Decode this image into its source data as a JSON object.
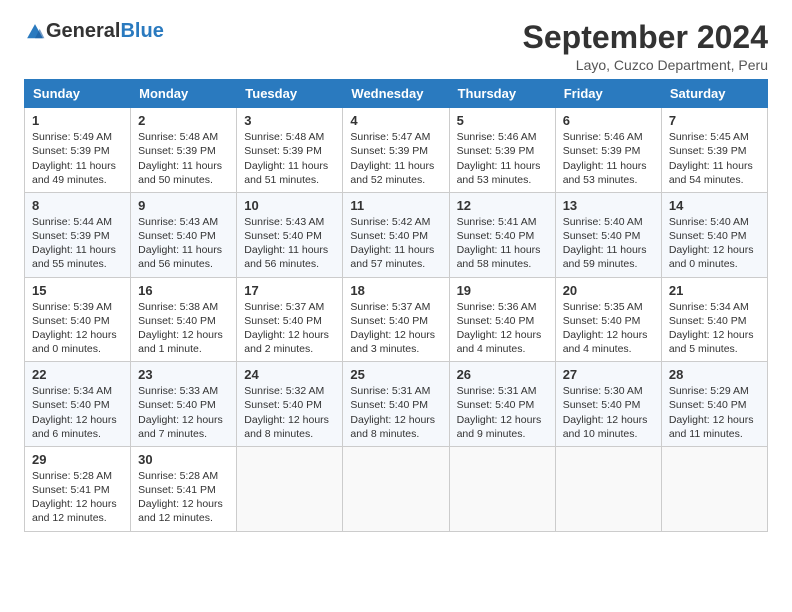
{
  "header": {
    "logo_general": "General",
    "logo_blue": "Blue",
    "month_title": "September 2024",
    "location": "Layo, Cuzco Department, Peru"
  },
  "weekdays": [
    "Sunday",
    "Monday",
    "Tuesday",
    "Wednesday",
    "Thursday",
    "Friday",
    "Saturday"
  ],
  "weeks": [
    [
      {
        "day": "1",
        "sunrise": "5:49 AM",
        "sunset": "5:39 PM",
        "daylight": "11 hours and 49 minutes."
      },
      {
        "day": "2",
        "sunrise": "5:48 AM",
        "sunset": "5:39 PM",
        "daylight": "11 hours and 50 minutes."
      },
      {
        "day": "3",
        "sunrise": "5:48 AM",
        "sunset": "5:39 PM",
        "daylight": "11 hours and 51 minutes."
      },
      {
        "day": "4",
        "sunrise": "5:47 AM",
        "sunset": "5:39 PM",
        "daylight": "11 hours and 52 minutes."
      },
      {
        "day": "5",
        "sunrise": "5:46 AM",
        "sunset": "5:39 PM",
        "daylight": "11 hours and 53 minutes."
      },
      {
        "day": "6",
        "sunrise": "5:46 AM",
        "sunset": "5:39 PM",
        "daylight": "11 hours and 53 minutes."
      },
      {
        "day": "7",
        "sunrise": "5:45 AM",
        "sunset": "5:39 PM",
        "daylight": "11 hours and 54 minutes."
      }
    ],
    [
      {
        "day": "8",
        "sunrise": "5:44 AM",
        "sunset": "5:39 PM",
        "daylight": "11 hours and 55 minutes."
      },
      {
        "day": "9",
        "sunrise": "5:43 AM",
        "sunset": "5:40 PM",
        "daylight": "11 hours and 56 minutes."
      },
      {
        "day": "10",
        "sunrise": "5:43 AM",
        "sunset": "5:40 PM",
        "daylight": "11 hours and 56 minutes."
      },
      {
        "day": "11",
        "sunrise": "5:42 AM",
        "sunset": "5:40 PM",
        "daylight": "11 hours and 57 minutes."
      },
      {
        "day": "12",
        "sunrise": "5:41 AM",
        "sunset": "5:40 PM",
        "daylight": "11 hours and 58 minutes."
      },
      {
        "day": "13",
        "sunrise": "5:40 AM",
        "sunset": "5:40 PM",
        "daylight": "11 hours and 59 minutes."
      },
      {
        "day": "14",
        "sunrise": "5:40 AM",
        "sunset": "5:40 PM",
        "daylight": "12 hours and 0 minutes."
      }
    ],
    [
      {
        "day": "15",
        "sunrise": "5:39 AM",
        "sunset": "5:40 PM",
        "daylight": "12 hours and 0 minutes."
      },
      {
        "day": "16",
        "sunrise": "5:38 AM",
        "sunset": "5:40 PM",
        "daylight": "12 hours and 1 minute."
      },
      {
        "day": "17",
        "sunrise": "5:37 AM",
        "sunset": "5:40 PM",
        "daylight": "12 hours and 2 minutes."
      },
      {
        "day": "18",
        "sunrise": "5:37 AM",
        "sunset": "5:40 PM",
        "daylight": "12 hours and 3 minutes."
      },
      {
        "day": "19",
        "sunrise": "5:36 AM",
        "sunset": "5:40 PM",
        "daylight": "12 hours and 4 minutes."
      },
      {
        "day": "20",
        "sunrise": "5:35 AM",
        "sunset": "5:40 PM",
        "daylight": "12 hours and 4 minutes."
      },
      {
        "day": "21",
        "sunrise": "5:34 AM",
        "sunset": "5:40 PM",
        "daylight": "12 hours and 5 minutes."
      }
    ],
    [
      {
        "day": "22",
        "sunrise": "5:34 AM",
        "sunset": "5:40 PM",
        "daylight": "12 hours and 6 minutes."
      },
      {
        "day": "23",
        "sunrise": "5:33 AM",
        "sunset": "5:40 PM",
        "daylight": "12 hours and 7 minutes."
      },
      {
        "day": "24",
        "sunrise": "5:32 AM",
        "sunset": "5:40 PM",
        "daylight": "12 hours and 8 minutes."
      },
      {
        "day": "25",
        "sunrise": "5:31 AM",
        "sunset": "5:40 PM",
        "daylight": "12 hours and 8 minutes."
      },
      {
        "day": "26",
        "sunrise": "5:31 AM",
        "sunset": "5:40 PM",
        "daylight": "12 hours and 9 minutes."
      },
      {
        "day": "27",
        "sunrise": "5:30 AM",
        "sunset": "5:40 PM",
        "daylight": "12 hours and 10 minutes."
      },
      {
        "day": "28",
        "sunrise": "5:29 AM",
        "sunset": "5:40 PM",
        "daylight": "12 hours and 11 minutes."
      }
    ],
    [
      {
        "day": "29",
        "sunrise": "5:28 AM",
        "sunset": "5:41 PM",
        "daylight": "12 hours and 12 minutes."
      },
      {
        "day": "30",
        "sunrise": "5:28 AM",
        "sunset": "5:41 PM",
        "daylight": "12 hours and 12 minutes."
      },
      null,
      null,
      null,
      null,
      null
    ]
  ]
}
